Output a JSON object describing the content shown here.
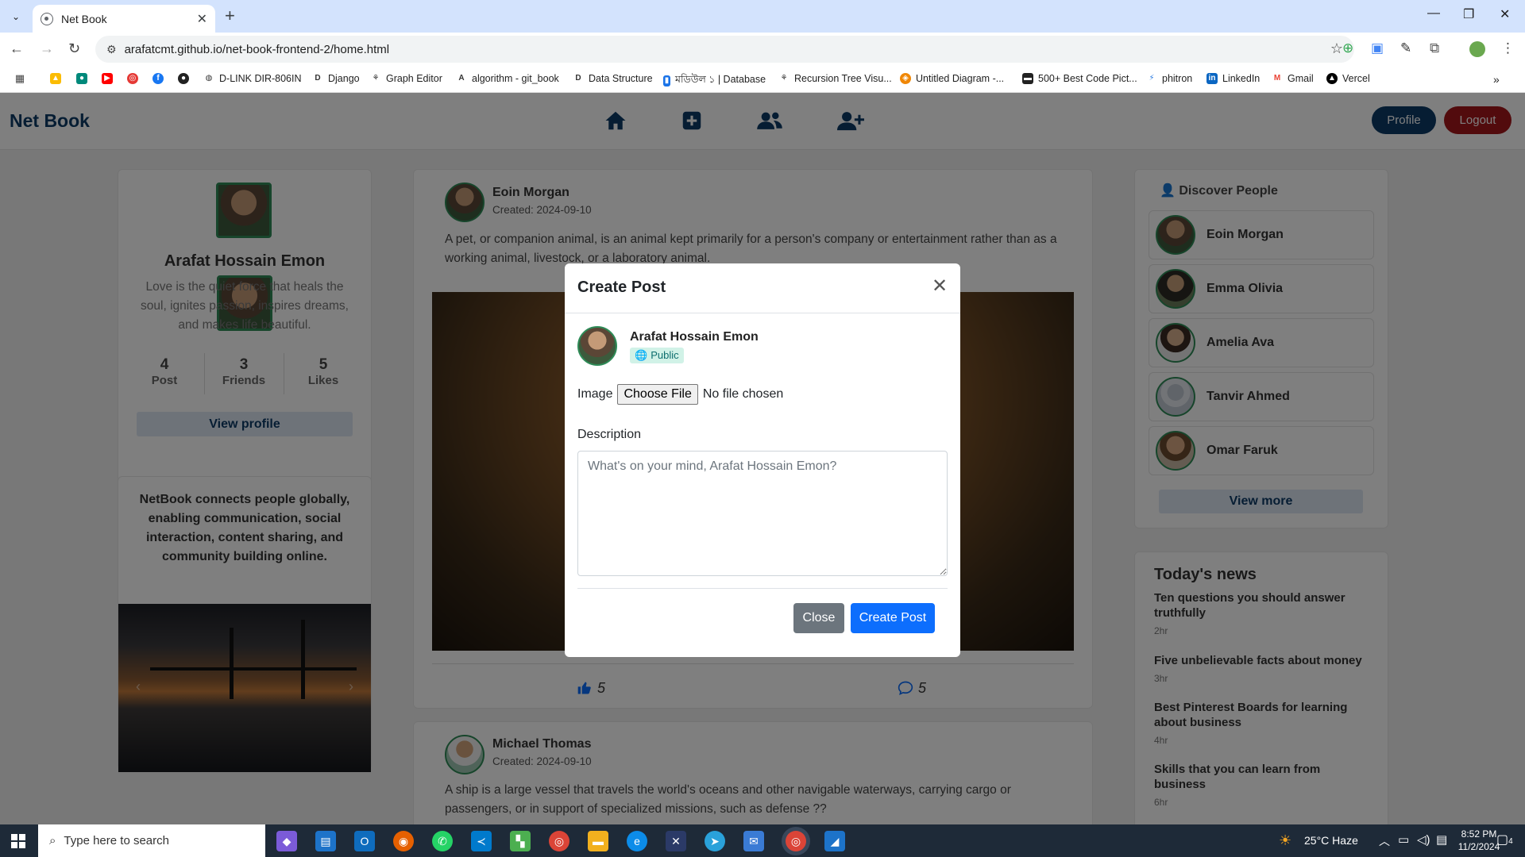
{
  "browser": {
    "tab_title": "Net Book",
    "url": "arafatcmt.github.io/net-book-frontend-2/home.html",
    "bookmarks": [
      "D-LINK DIR-806IN",
      "Django",
      "Graph Editor",
      "algorithm - git_book",
      "Data Structure",
      "মডিউল ১ | Database",
      "Recursion Tree Visu...",
      "Untitled Diagram -...",
      "500+ Best Code Pict...",
      "phitron",
      "LinkedIn",
      "Gmail",
      "Vercel"
    ]
  },
  "navbar": {
    "brand": "Net Book",
    "profile_label": "Profile",
    "logout_label": "Logout"
  },
  "profile": {
    "name": "Arafat Hossain Emon",
    "bio": "Love is the quiet force that heals the soul, ignites passion, inspires dreams, and makes life beautiful.",
    "stats": [
      {
        "value": "4",
        "label": "Post"
      },
      {
        "value": "3",
        "label": "Friends"
      },
      {
        "value": "5",
        "label": "Likes"
      }
    ],
    "view_profile": "View profile"
  },
  "about": {
    "text": "NetBook connects people globally, enabling communication, social interaction, content sharing, and community building online."
  },
  "posts": [
    {
      "author": "Eoin Morgan",
      "created": "Created: 2024-09-10",
      "text": "A pet, or companion animal, is an animal kept primarily for a person's company or entertainment rather than as a working animal, livestock, or a laboratory animal.",
      "likes": "5",
      "comments": "5"
    },
    {
      "author": "Michael Thomas",
      "created": "Created: 2024-09-10",
      "text": "A ship is a large vessel that travels the world's oceans and other navigable waterways, carrying cargo or passengers, or in support of specialized missions, such as defense ??"
    }
  ],
  "discover": {
    "title": "Discover People",
    "people": [
      "Eoin Morgan",
      "Emma Olivia",
      "Amelia Ava",
      "Tanvir Ahmed",
      "Omar Faruk"
    ],
    "view_more": "View more"
  },
  "news": {
    "title": "Today's news",
    "items": [
      {
        "title": "Ten questions you should answer truthfully",
        "time": "2hr"
      },
      {
        "title": "Five unbelievable facts about money",
        "time": "3hr"
      },
      {
        "title": "Best Pinterest Boards for learning about business",
        "time": "4hr"
      },
      {
        "title": "Skills that you can learn from business",
        "time": "6hr"
      }
    ]
  },
  "modal": {
    "title": "Create Post",
    "user": "Arafat Hossain Emon",
    "visibility": "Public",
    "image_label": "Image",
    "choose_file": "Choose File",
    "no_file": "No file chosen",
    "description_label": "Description",
    "placeholder": "What's on your mind, Arafat Hossain Emon?",
    "close": "Close",
    "create": "Create Post"
  },
  "taskbar": {
    "search_placeholder": "Type here to search",
    "weather": "25°C Haze",
    "time": "8:52 PM",
    "date": "11/2/2024",
    "notifications": "4"
  },
  "colors": {
    "brand": "#0d3b66",
    "logout": "#a4161a",
    "primary": "#0d6efd",
    "secondary": "#6c757d",
    "accent_green": "#2e8b57"
  }
}
